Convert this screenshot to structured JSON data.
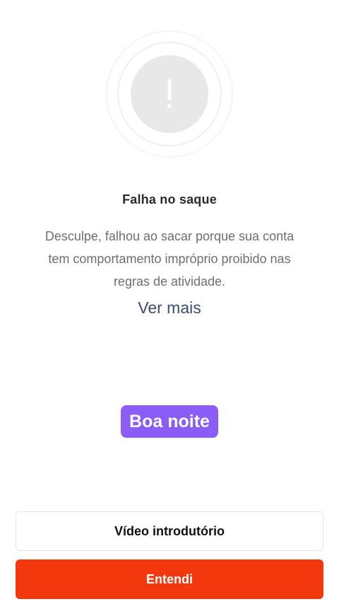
{
  "dialog": {
    "title": "Falha no saque",
    "message": "Desculpe, falhou ao sacar porque sua conta tem comportamento impróprio proibido nas regras de atividade.",
    "see_more_link": "Ver mais",
    "icon": "exclamation-icon"
  },
  "greeting_badge": {
    "label": "Boa noite",
    "color": "#8b5cf6"
  },
  "buttons": {
    "intro_video_label": "Vídeo introdutório",
    "confirm_label": "Entendi",
    "confirm_color": "#f2380c"
  }
}
